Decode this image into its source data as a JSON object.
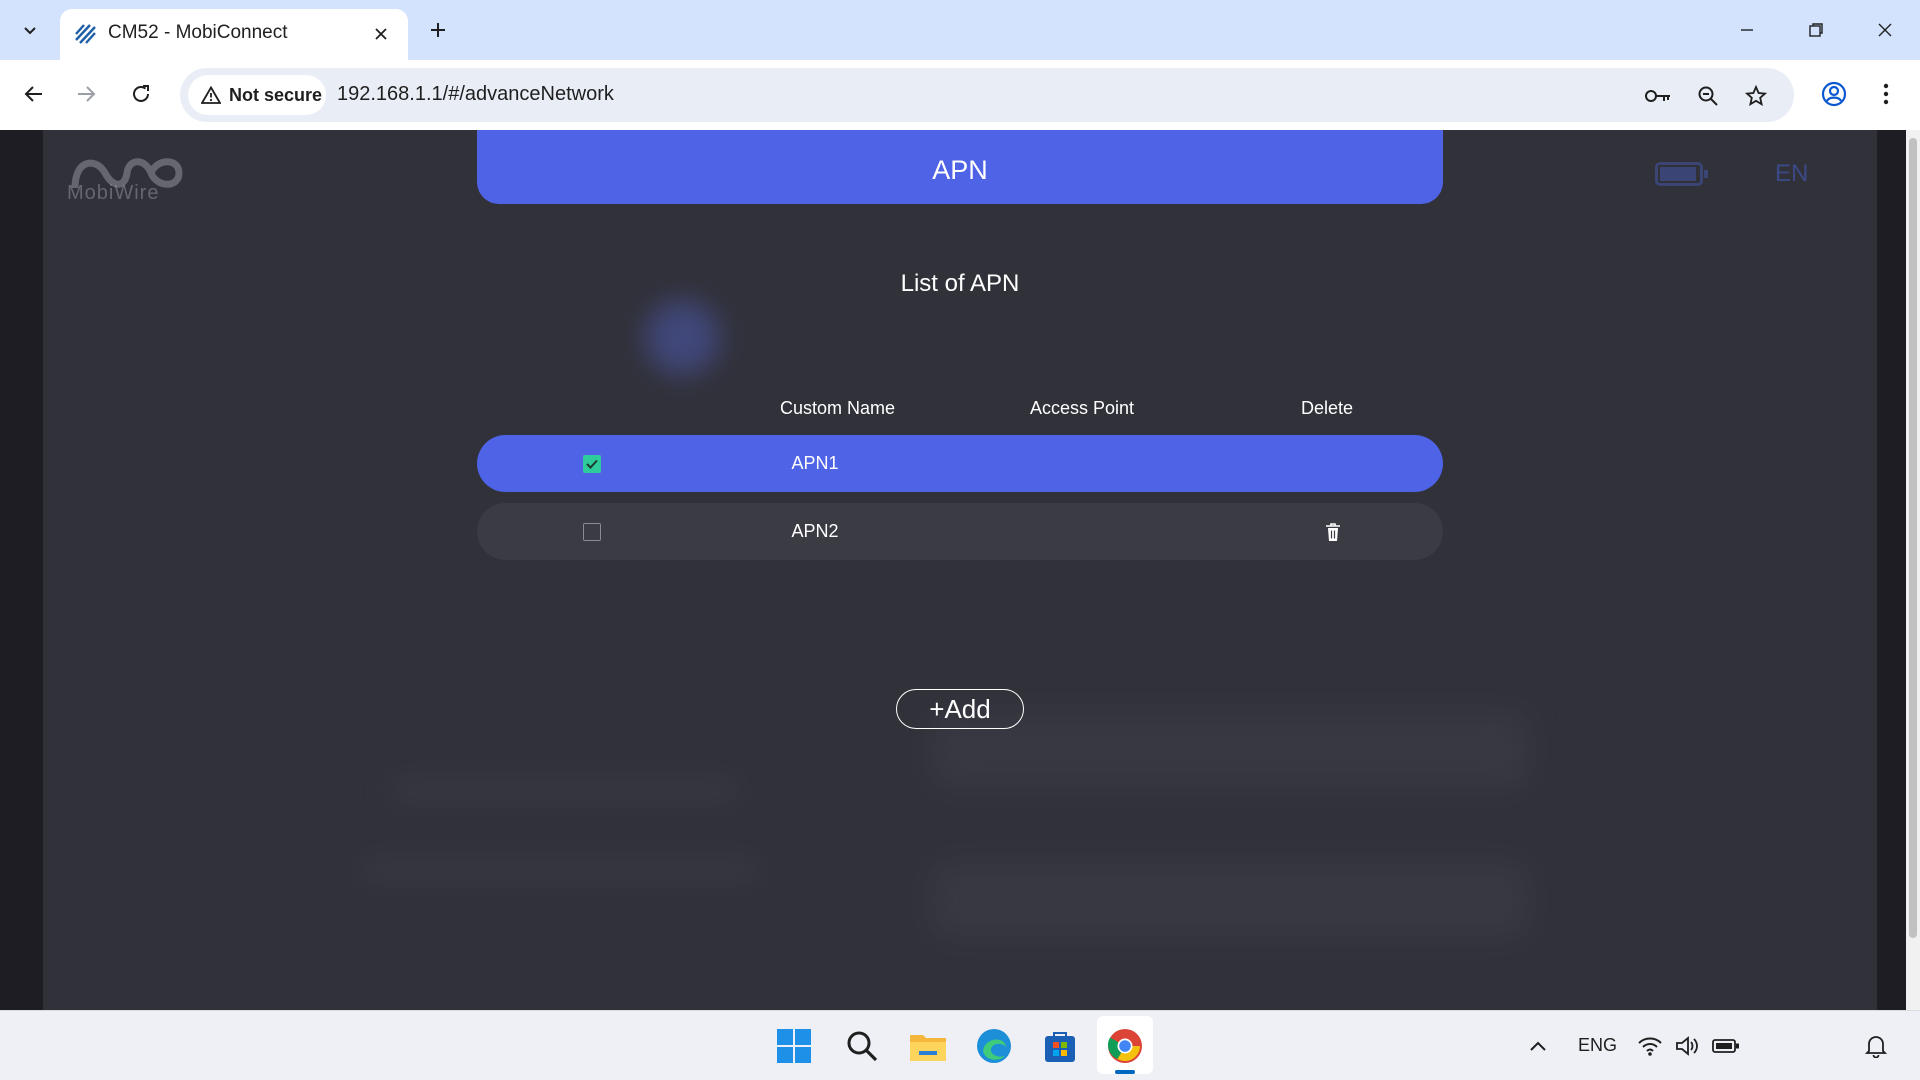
{
  "browser": {
    "tab_title": "CM52 - MobiConnect",
    "security_label": "Not secure",
    "url": "192.168.1.1/#/advanceNetwork"
  },
  "page": {
    "logo_text": "MobiWire",
    "language": "EN"
  },
  "apn_modal": {
    "header": "APN",
    "list_title": "List of APN",
    "columns": [
      "Custom Name",
      "Access Point",
      "Delete"
    ],
    "rows": [
      {
        "name": "APN1",
        "access_point": "",
        "selected": true,
        "deletable": false
      },
      {
        "name": "APN2",
        "access_point": "",
        "selected": false,
        "deletable": true
      }
    ],
    "add_label": "+Add"
  },
  "taskbar": {
    "language": "ENG"
  },
  "colors": {
    "accent": "#4e63e6",
    "checkbox_on": "#2ecc9a",
    "card_bg": "#31313a"
  }
}
